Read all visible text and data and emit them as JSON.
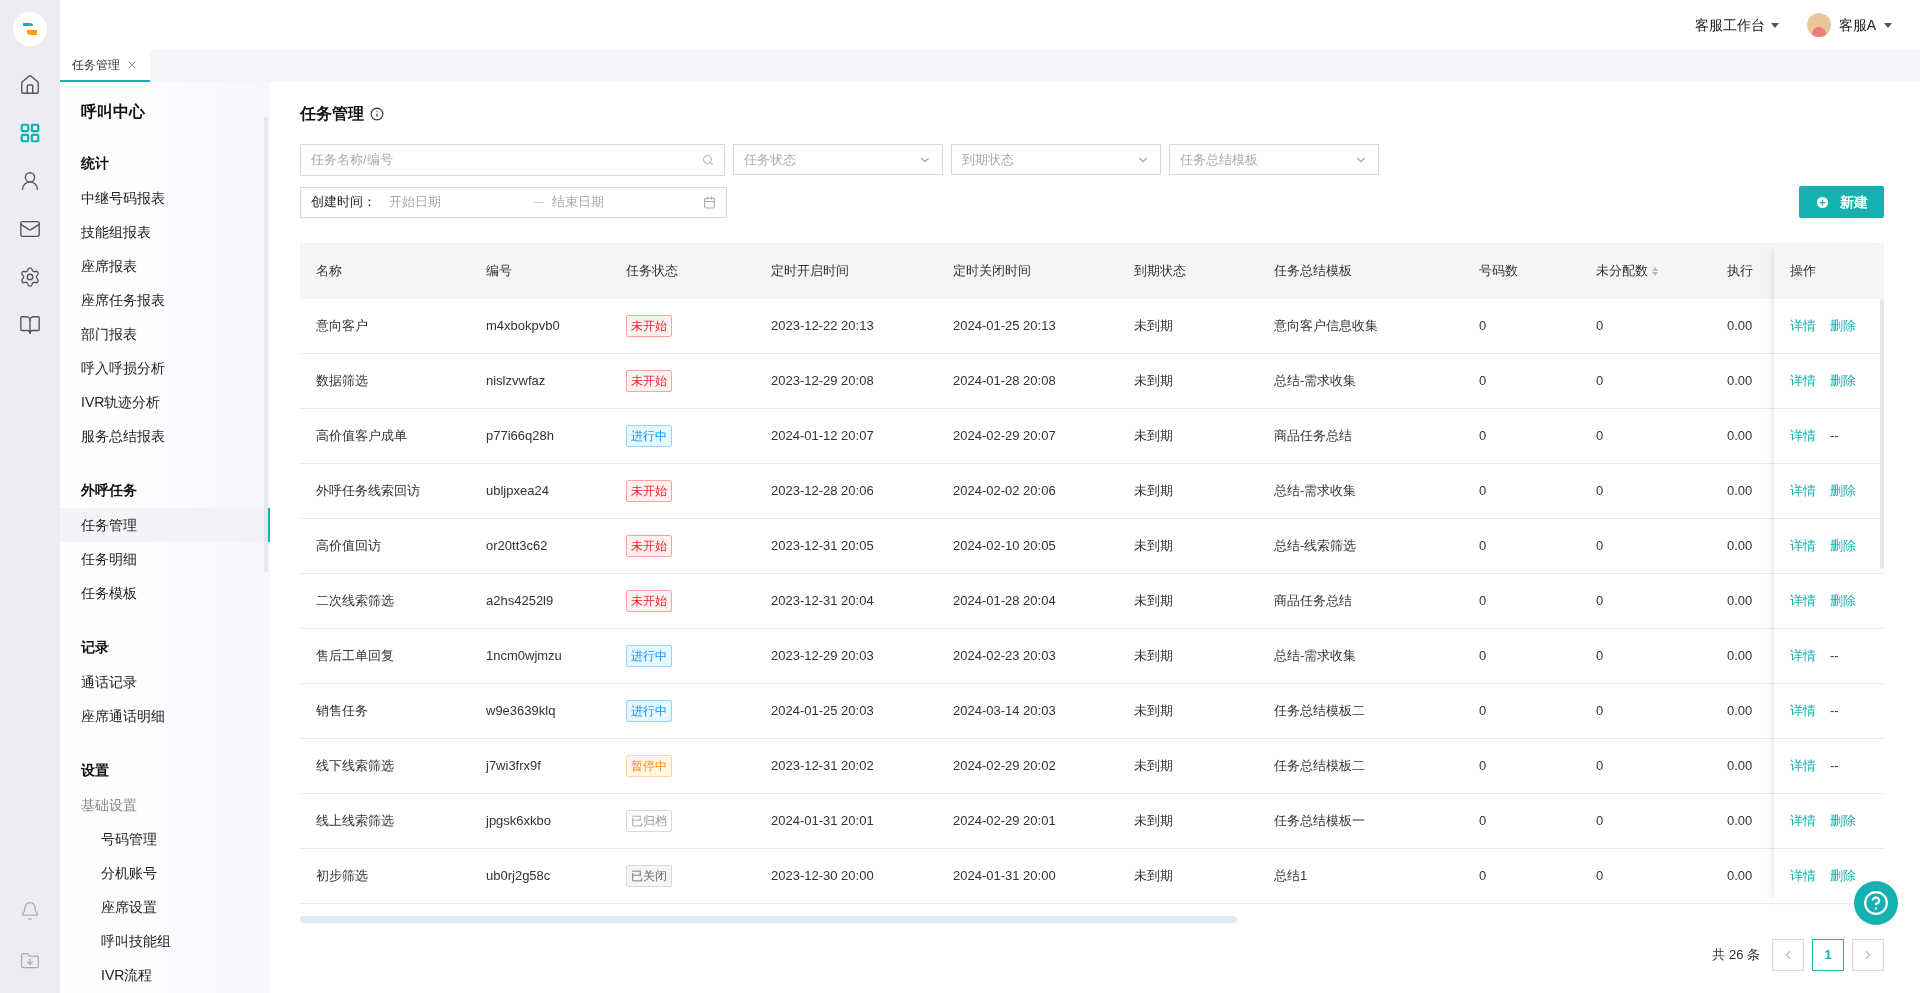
{
  "header": {
    "workspace": "客服工作台",
    "user": "客服A"
  },
  "rail": [
    {
      "selected": false
    },
    {
      "selected": true
    },
    {
      "selected": false
    },
    {
      "selected": false
    },
    {
      "selected": false
    },
    {
      "selected": false
    }
  ],
  "tabs": [
    {
      "label": "任务管理",
      "selected": true
    }
  ],
  "sidebar": {
    "title": "呼叫中心",
    "sections": [
      {
        "heading": "统计",
        "items": [
          {
            "label": "中继号码报表",
            "selected": false
          },
          {
            "label": "技能组报表",
            "selected": false
          },
          {
            "label": "座席报表",
            "selected": false
          },
          {
            "label": "座席任务报表",
            "selected": false
          },
          {
            "label": "部门报表",
            "selected": false
          },
          {
            "label": "呼入呼损分析",
            "selected": false
          },
          {
            "label": "IVR轨迹分析",
            "selected": false
          },
          {
            "label": "服务总结报表",
            "selected": false
          }
        ]
      },
      {
        "heading": "外呼任务",
        "items": [
          {
            "label": "任务管理",
            "selected": true
          },
          {
            "label": "任务明细",
            "selected": false
          },
          {
            "label": "任务模板",
            "selected": false
          }
        ]
      },
      {
        "heading": "记录",
        "items": [
          {
            "label": "通话记录",
            "selected": false
          },
          {
            "label": "座席通话明细",
            "selected": false
          }
        ]
      },
      {
        "heading": "设置",
        "items": [
          {
            "label": "基础设置",
            "selected": false,
            "children": [
              {
                "label": "号码管理",
                "selected": false
              },
              {
                "label": "分机账号",
                "selected": false
              },
              {
                "label": "座席设置",
                "selected": false
              },
              {
                "label": "呼叫技能组",
                "selected": false
              },
              {
                "label": "IVR流程",
                "selected": false
              }
            ]
          }
        ]
      }
    ]
  },
  "page": {
    "title": "任务管理",
    "filters": {
      "search": {
        "placeholder": "任务名称/编号"
      },
      "selects": [
        {
          "placeholder": "任务状态"
        },
        {
          "placeholder": "到期状态"
        },
        {
          "placeholder": "任务总结模板"
        }
      ],
      "date_range": {
        "label": "创建时间：",
        "start_placeholder": "开始日期",
        "end_placeholder": "结束日期"
      }
    },
    "new_button": "新建",
    "table": {
      "columns": [
        {
          "label": "名称",
          "sortable": false
        },
        {
          "label": "编号",
          "sortable": false
        },
        {
          "label": "任务状态",
          "sortable": false
        },
        {
          "label": "定时开启时间",
          "sortable": false
        },
        {
          "label": "定时关闭时间",
          "sortable": false
        },
        {
          "label": "到期状态",
          "sortable": false
        },
        {
          "label": "任务总结模板",
          "sortable": false
        },
        {
          "label": "号码数",
          "sortable": false
        },
        {
          "label": "未分配数",
          "sortable": true
        },
        {
          "label": "执行",
          "sortable": false
        }
      ],
      "actions_column": "操作",
      "rows": [
        {
          "name": "意向客户",
          "code": "m4xbokpvb0",
          "status": {
            "label": "未开始",
            "kind": "not_started"
          },
          "start": "2023-12-22 20:13",
          "end": "2024-01-25 20:13",
          "due": "未到期",
          "template": "意向客户信息收集",
          "numbers": "0",
          "unassigned": "0",
          "rate": "0.00",
          "actions": [
            {
              "label": "详情",
              "kind": "link"
            },
            {
              "label": "删除",
              "kind": "link"
            }
          ]
        },
        {
          "name": "数据筛选",
          "code": "nislzvwfaz",
          "status": {
            "label": "未开始",
            "kind": "not_started"
          },
          "start": "2023-12-29 20:08",
          "end": "2024-01-28 20:08",
          "due": "未到期",
          "template": "总结-需求收集",
          "numbers": "0",
          "unassigned": "0",
          "rate": "0.00",
          "actions": [
            {
              "label": "详情",
              "kind": "link"
            },
            {
              "label": "删除",
              "kind": "link"
            }
          ]
        },
        {
          "name": "高价值客户成单",
          "code": "p77i66q28h",
          "status": {
            "label": "进行中",
            "kind": "running"
          },
          "start": "2024-01-12 20:07",
          "end": "2024-02-29 20:07",
          "due": "未到期",
          "template": "商品任务总结",
          "numbers": "0",
          "unassigned": "0",
          "rate": "0.00",
          "actions": [
            {
              "label": "详情",
              "kind": "link"
            },
            {
              "label": "--",
              "kind": "none"
            }
          ]
        },
        {
          "name": "外呼任务线索回访",
          "code": "ubljpxea24",
          "status": {
            "label": "未开始",
            "kind": "not_started"
          },
          "start": "2023-12-28 20:06",
          "end": "2024-02-02 20:06",
          "due": "未到期",
          "template": "总结-需求收集",
          "numbers": "0",
          "unassigned": "0",
          "rate": "0.00",
          "actions": [
            {
              "label": "详情",
              "kind": "link"
            },
            {
              "label": "删除",
              "kind": "link"
            }
          ]
        },
        {
          "name": "高价值回访",
          "code": "or20tt3c62",
          "status": {
            "label": "未开始",
            "kind": "not_started"
          },
          "start": "2023-12-31 20:05",
          "end": "2024-02-10 20:05",
          "due": "未到期",
          "template": "总结-线索筛选",
          "numbers": "0",
          "unassigned": "0",
          "rate": "0.00",
          "actions": [
            {
              "label": "详情",
              "kind": "link"
            },
            {
              "label": "删除",
              "kind": "link"
            }
          ]
        },
        {
          "name": "二次线索筛选",
          "code": "a2hs4252l9",
          "status": {
            "label": "未开始",
            "kind": "not_started"
          },
          "start": "2023-12-31 20:04",
          "end": "2024-01-28 20:04",
          "due": "未到期",
          "template": "商品任务总结",
          "numbers": "0",
          "unassigned": "0",
          "rate": "0.00",
          "actions": [
            {
              "label": "详情",
              "kind": "link"
            },
            {
              "label": "删除",
              "kind": "link"
            }
          ]
        },
        {
          "name": "售后工单回复",
          "code": "1ncm0wjmzu",
          "status": {
            "label": "进行中",
            "kind": "running"
          },
          "start": "2023-12-29 20:03",
          "end": "2024-02-23 20:03",
          "due": "未到期",
          "template": "总结-需求收集",
          "numbers": "0",
          "unassigned": "0",
          "rate": "0.00",
          "actions": [
            {
              "label": "详情",
              "kind": "link"
            },
            {
              "label": "--",
              "kind": "none"
            }
          ]
        },
        {
          "name": "销售任务",
          "code": "w9e3639klq",
          "status": {
            "label": "进行中",
            "kind": "running"
          },
          "start": "2024-01-25 20:03",
          "end": "2024-03-14 20:03",
          "due": "未到期",
          "template": "任务总结模板二",
          "numbers": "0",
          "unassigned": "0",
          "rate": "0.00",
          "actions": [
            {
              "label": "详情",
              "kind": "link"
            },
            {
              "label": "--",
              "kind": "none"
            }
          ]
        },
        {
          "name": "线下线索筛选",
          "code": "j7wi3frx9f",
          "status": {
            "label": "暂停中",
            "kind": "paused"
          },
          "start": "2023-12-31 20:02",
          "end": "2024-02-29 20:02",
          "due": "未到期",
          "template": "任务总结模板二",
          "numbers": "0",
          "unassigned": "0",
          "rate": "0.00",
          "actions": [
            {
              "label": "详情",
              "kind": "link"
            },
            {
              "label": "--",
              "kind": "none"
            }
          ]
        },
        {
          "name": "线上线索筛选",
          "code": "jpgsk6xkbo",
          "status": {
            "label": "已归档",
            "kind": "archived"
          },
          "start": "2024-01-31 20:01",
          "end": "2024-02-29 20:01",
          "due": "未到期",
          "template": "任务总结模板一",
          "numbers": "0",
          "unassigned": "0",
          "rate": "0.00",
          "actions": [
            {
              "label": "详情",
              "kind": "link"
            },
            {
              "label": "删除",
              "kind": "link"
            }
          ]
        },
        {
          "name": "初步筛选",
          "code": "ub0rj2g58c",
          "status": {
            "label": "已关闭",
            "kind": "closed"
          },
          "start": "2023-12-30 20:00",
          "end": "2024-01-31 20:00",
          "due": "未到期",
          "template": "总结1",
          "numbers": "0",
          "unassigned": "0",
          "rate": "0.00",
          "actions": [
            {
              "label": "详情",
              "kind": "link"
            },
            {
              "label": "删除",
              "kind": "link"
            }
          ]
        }
      ]
    },
    "pagination": {
      "total": "共 26 条",
      "pages": [
        {
          "label": "1",
          "selected": true
        }
      ]
    }
  }
}
